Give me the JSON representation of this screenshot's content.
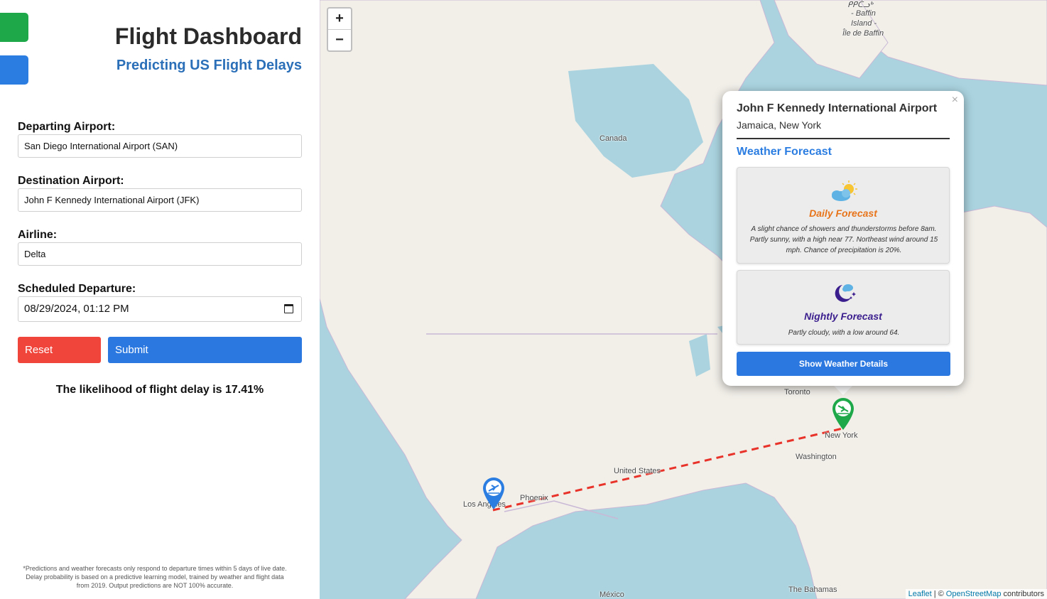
{
  "header": {
    "title": "Flight Dashboard",
    "subtitle": "Predicting US Flight Delays"
  },
  "form": {
    "departing_label": "Departing Airport:",
    "departing_value": "San Diego International Airport (SAN)",
    "destination_label": "Destination Airport:",
    "destination_value": "John F Kennedy International Airport (JFK)",
    "airline_label": "Airline:",
    "airline_value": "Delta",
    "departure_label": "Scheduled Departure:",
    "departure_value": "08/29/2024, 01:12 PM",
    "reset_label": "Reset",
    "submit_label": "Submit"
  },
  "result": {
    "likelihood_text": "The likelihood of flight delay is 17.41%",
    "delay_probability_percent": 17.41
  },
  "disclaimer": "*Predictions and weather forecasts only respond to departure times within 5 days of live date. Delay probability is based on a predictive learning model, trained by weather and flight data from 2019. Output predictions are NOT 100% accurate.",
  "map": {
    "zoom_in": "+",
    "zoom_out": "−",
    "labels": {
      "baffin_1": "ᑭᑭᑖᓗᒃ",
      "baffin_2": "- Baffin",
      "baffin_3": "Island -",
      "baffin_4": "Île de Baffin",
      "canada": "Canada",
      "toronto": "Toronto",
      "new_york": "New York",
      "washington": "Washington",
      "united_states": "United States",
      "phoenix": "Phoenix",
      "los_angeles": "Los Angeles",
      "mexico": "México",
      "bahamas": "The Bahamas"
    },
    "attribution": {
      "leaflet": "Leaflet",
      "separator": "| ©",
      "osm": "OpenStreetMap",
      "contributors": "contributors"
    },
    "route_color": "#e8332a",
    "origin_marker_color": "#2b7de1",
    "destination_marker_color": "#1ea84a"
  },
  "popup": {
    "close": "×",
    "airport_name": "John F Kennedy International Airport",
    "city": "Jamaica, New York",
    "weather_heading": "Weather Forecast",
    "daily": {
      "icon": "partly-sunny-icon",
      "title": "Daily Forecast",
      "text": "A slight chance of showers and thunderstorms before 8am. Partly sunny, with a high near 77. Northeast wind around 15 mph. Chance of precipitation is 20%."
    },
    "nightly": {
      "icon": "partly-cloudy-night-icon",
      "title": "Nightly Forecast",
      "text": "Partly cloudy, with a low around 64."
    },
    "details_button": "Show Weather Details"
  }
}
